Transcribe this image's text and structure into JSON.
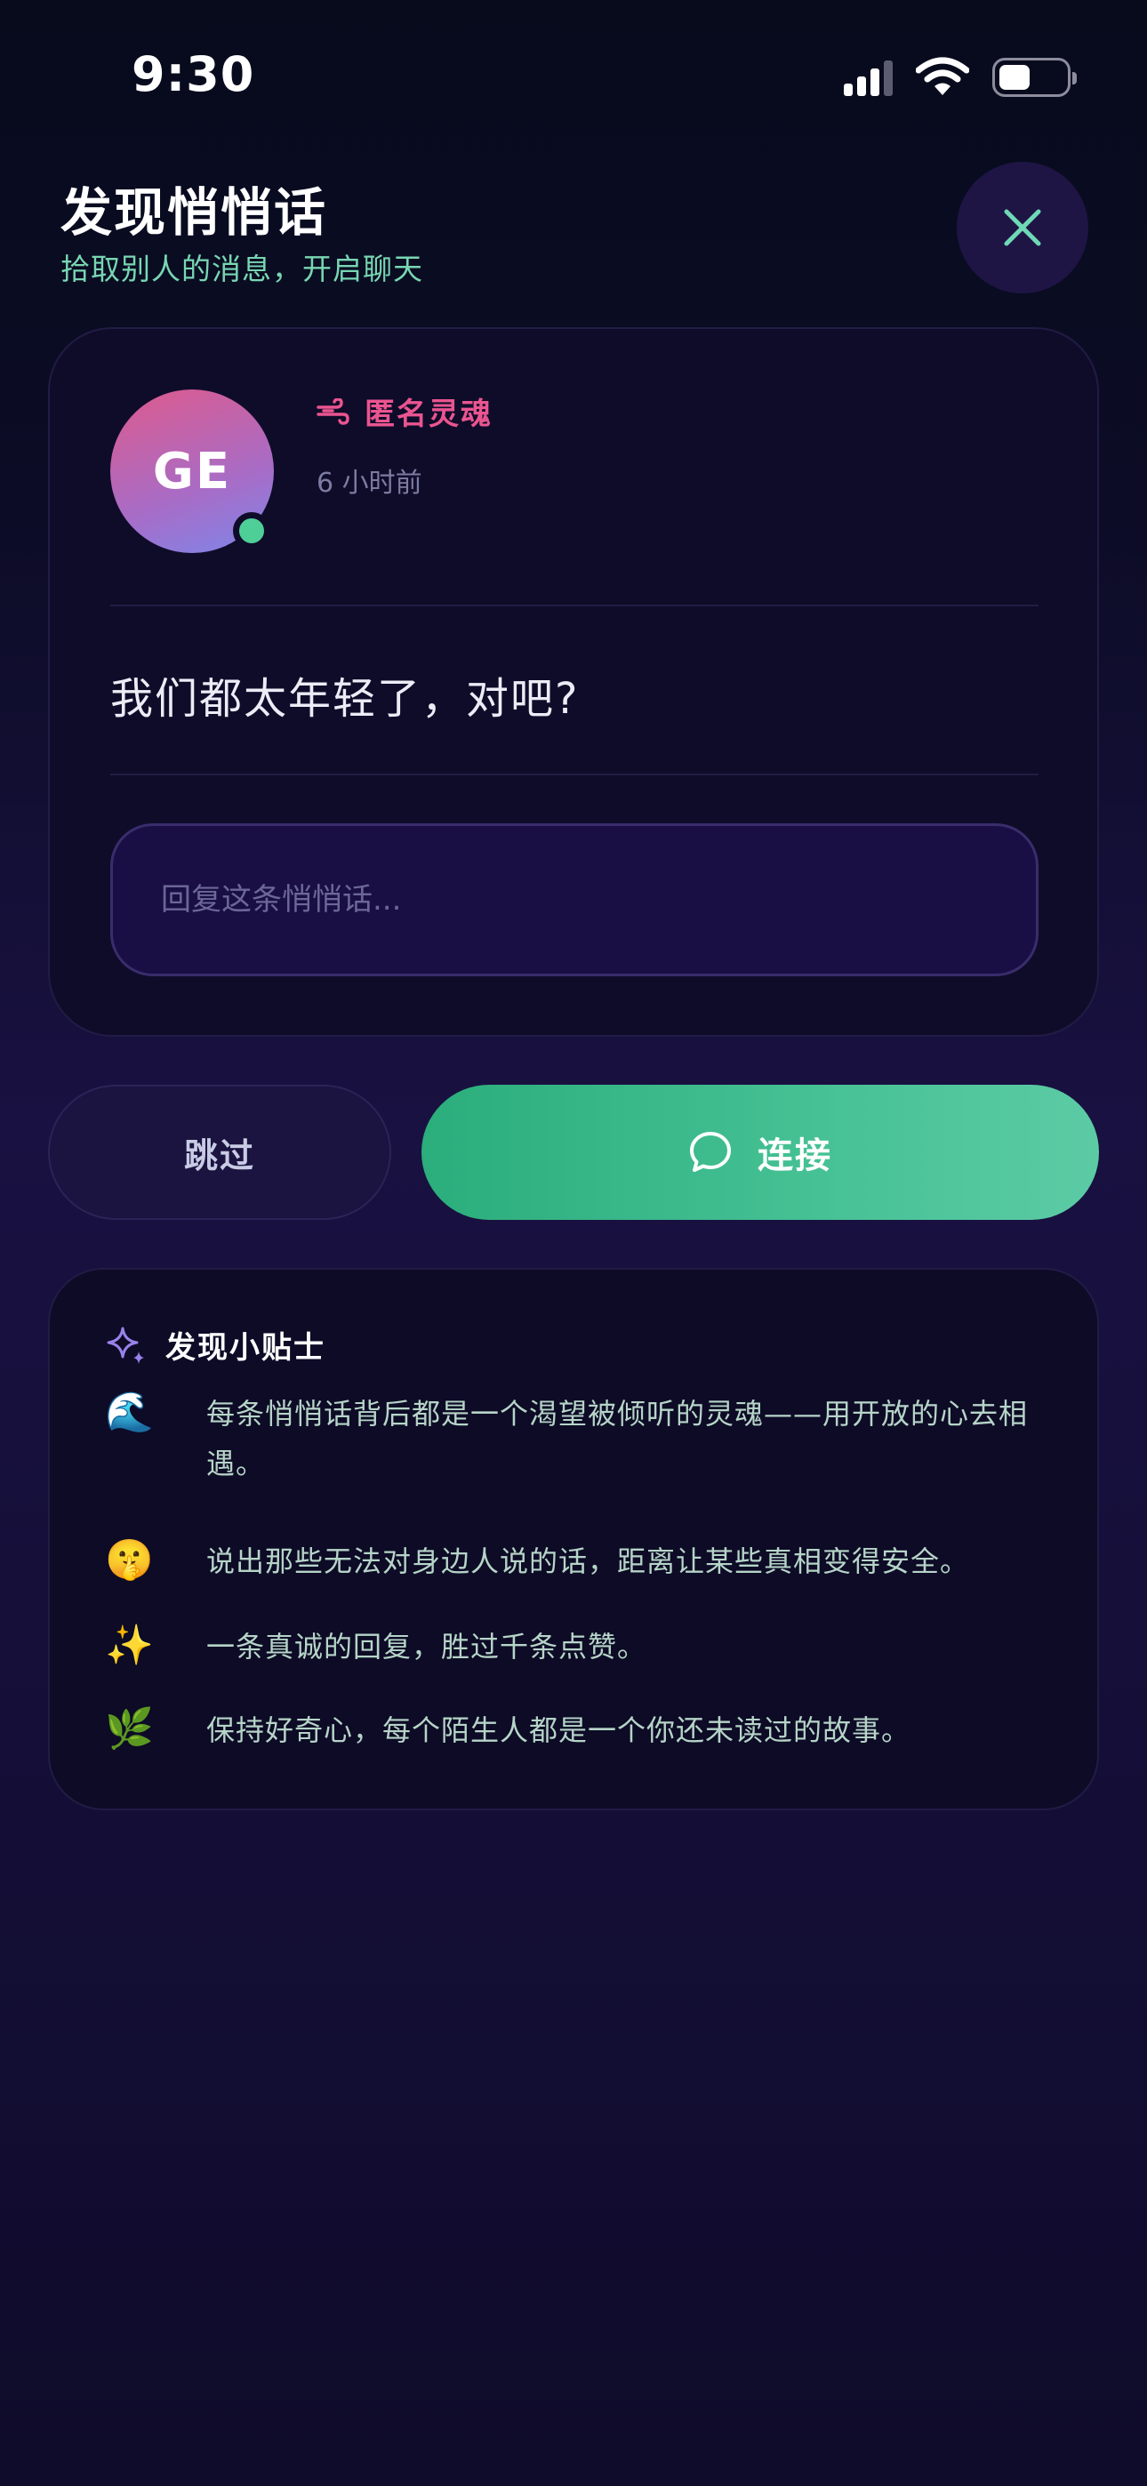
{
  "status_bar": {
    "time": "9:30",
    "icons": [
      "signal-icon",
      "wifi-icon",
      "battery-icon"
    ]
  },
  "header": {
    "title": "发现悄悄话",
    "subtitle": "拾取别人的消息，开启聊天",
    "close_icon": "close-icon"
  },
  "whisper": {
    "avatar_initials": "GE",
    "author_icon": "wind-icon",
    "author": "匿名灵魂",
    "time": "6 小时前",
    "message": "我们都太年轻了，对吧?",
    "reply_placeholder": "回复这条悄悄话..."
  },
  "actions": {
    "skip_label": "跳过",
    "connect_label": "连接",
    "connect_icon": "chat-bubble-icon"
  },
  "tips": {
    "header_icon": "sparkle-icon",
    "title": "发现小贴士",
    "items": [
      {
        "icon": "🌊",
        "text": "每条悄悄话背后都是一个渴望被倾听的灵魂——用开放的心去相遇。"
      },
      {
        "icon": "🤫",
        "text": "说出那些无法对身边人说的话，距离让某些真相变得安全。"
      },
      {
        "icon": "✨",
        "text": "一条真诚的回复，胜过千条点赞。"
      },
      {
        "icon": "🌿",
        "text": "保持好奇心，每个陌生人都是一个你还未读过的故事。"
      }
    ]
  },
  "colors": {
    "accent_green": "#3dba8a",
    "author_pink": "#ea5590",
    "subtitle_green": "#78d6b2",
    "background_dark": "#0f0c2a"
  }
}
